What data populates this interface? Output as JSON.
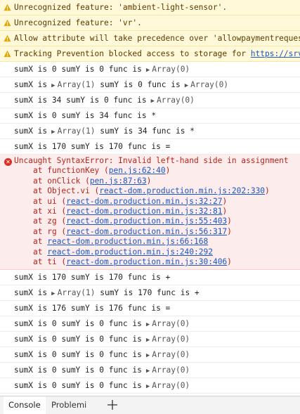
{
  "warnings": [
    {
      "text": "Unrecognized feature: 'ambient-light-sensor'."
    },
    {
      "text": "Unrecognized feature: 'vr'."
    },
    {
      "text": "Allow attribute will take precedence over 'allowpaymentrequest'"
    },
    {
      "text": "Tracking Prevention blocked access to storage for ",
      "link": "https://srv."
    }
  ],
  "logs_before": [
    {
      "pre": "sumX is 0 sumY is 0 func is",
      "arr": "Array(0)"
    },
    {
      "pre": "sumX is",
      "arr1": "Array(1)",
      "mid": "sumY is 0 func is",
      "arr": "Array(0)"
    },
    {
      "pre": "sumX is 34 sumY is 0 func is",
      "arr": "Array(0)"
    },
    {
      "pre": "sumX is 0 sumY is 34 func is *"
    },
    {
      "pre": "sumX is",
      "arr1": "Array(1)",
      "mid": "sumY is 34 func is *"
    },
    {
      "pre": "sumX is 170 sumY is 170 func is ="
    }
  ],
  "error": {
    "message": "Uncaught SyntaxError: Invalid left-hand side in assignment",
    "frames": [
      {
        "prefix": "at functionKey (",
        "link": "pen.js:62:40",
        "suffix": ")"
      },
      {
        "prefix": "at onClick (",
        "link": "pen.js:87:63",
        "suffix": ")"
      },
      {
        "prefix": "at Object.vi (",
        "link": "react-dom.production.min.js:202:330",
        "suffix": ")"
      },
      {
        "prefix": "at ui (",
        "link": "react-dom.production.min.js:32:27",
        "suffix": ")"
      },
      {
        "prefix": "at xi (",
        "link": "react-dom.production.min.js:32:81",
        "suffix": ")"
      },
      {
        "prefix": "at zg (",
        "link": "react-dom.production.min.js:55:403",
        "suffix": ")"
      },
      {
        "prefix": "at rg (",
        "link": "react-dom.production.min.js:56:317",
        "suffix": ")"
      },
      {
        "prefix": "at ",
        "link": "react-dom.production.min.js:66:168",
        "suffix": ""
      },
      {
        "prefix": "at ",
        "link": "react-dom.production.min.js:240:292",
        "suffix": ""
      },
      {
        "prefix": "at ti (",
        "link": "react-dom.production.min.js:30:406",
        "suffix": ")"
      }
    ]
  },
  "logs_after": [
    {
      "pre": "sumX is 170 sumY is 170 func is +"
    },
    {
      "pre": "sumX is",
      "arr1": "Array(1)",
      "mid": "sumY is 170 func is +"
    },
    {
      "pre": "sumX is 176 sumY is 176 func is ="
    },
    {
      "pre": "sumX is 0 sumY is 0 func is",
      "arr": "Array(0)"
    },
    {
      "pre": "sumX is 0 sumY is 0 func is",
      "arr": "Array(0)"
    },
    {
      "pre": "sumX is 0 sumY is 0 func is",
      "arr": "Array(0)"
    },
    {
      "pre": "sumX is 0 sumY is 0 func is",
      "arr": "Array(0)"
    },
    {
      "pre": "sumX is 0 sumY is 0 func is",
      "arr": "Array(0)"
    }
  ],
  "tabs": {
    "console": "Console",
    "problems": "Problemi"
  },
  "icons": {
    "warning": "warning-icon",
    "error": "error-icon",
    "expand": "expand-triangle-icon",
    "add": "plus-icon"
  },
  "colors": {
    "warning_bg": "#fff9da",
    "error_bg": "#fdecec",
    "error_text": "#b3261e",
    "link": "#1a57c4"
  }
}
